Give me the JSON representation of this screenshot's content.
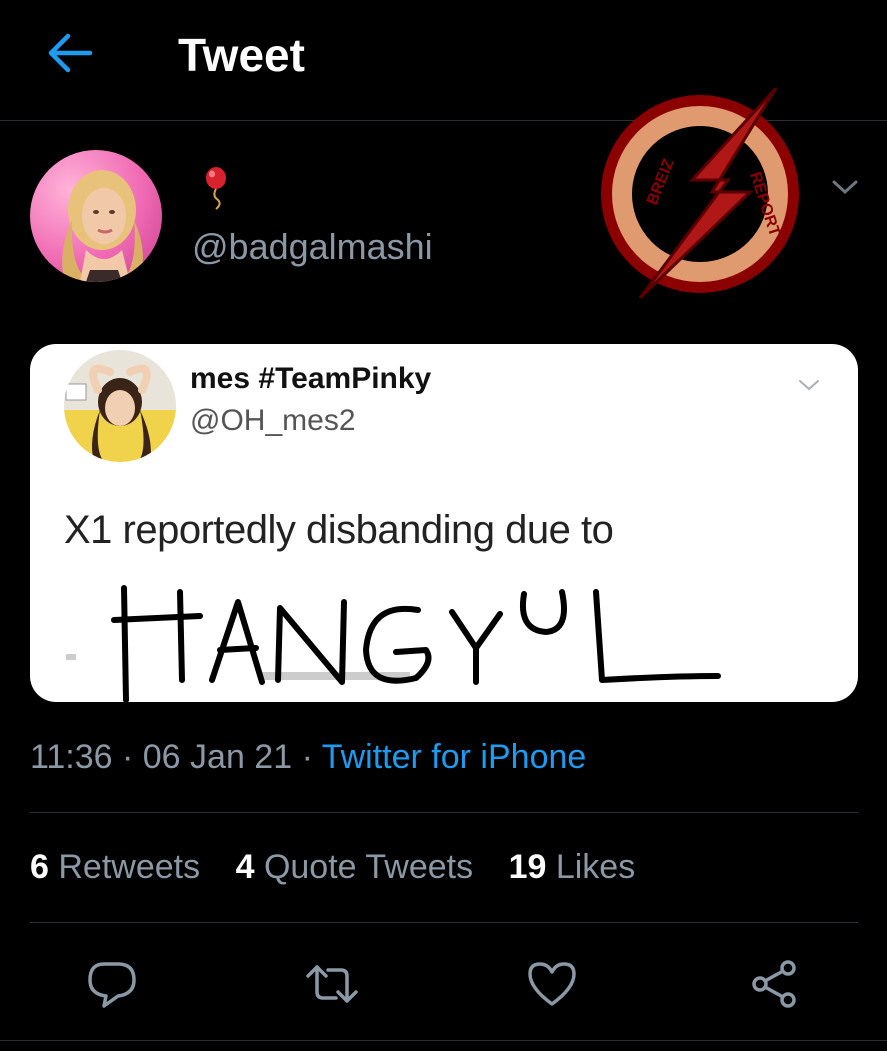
{
  "header": {
    "title": "Tweet",
    "back_icon": "back-arrow-icon"
  },
  "tweet": {
    "handle": "@badgalmashi",
    "name_icon": "balloon-icon",
    "menu_icon": "chevron-down-icon",
    "timestamp": "11:36 · 06 Jan 21 · ",
    "source": "Twitter for iPhone"
  },
  "watermark": {
    "text_top": "BREIZ",
    "text_right": "REPORT",
    "colors": [
      "#8b0000",
      "#e09a6f"
    ]
  },
  "quoted_tweet": {
    "name": "mes #TeamPinky",
    "handle": "@OH_mes2",
    "menu_icon": "chevron-down-icon",
    "text": "X1 reportedly disbanding due to",
    "handwritten_overlay": "HANGYUL"
  },
  "stats": {
    "retweets_count": "6",
    "retweets_label": "Retweets",
    "quotes_count": "4",
    "quotes_label": "Quote Tweets",
    "likes_count": "19",
    "likes_label": "Likes"
  },
  "actions": [
    "reply-icon",
    "retweet-icon",
    "like-icon",
    "share-icon"
  ],
  "colors": {
    "background": "#000000",
    "accent": "#1d9bf0",
    "secondary_text": "#8b98a5",
    "divider": "#2b2f33"
  }
}
